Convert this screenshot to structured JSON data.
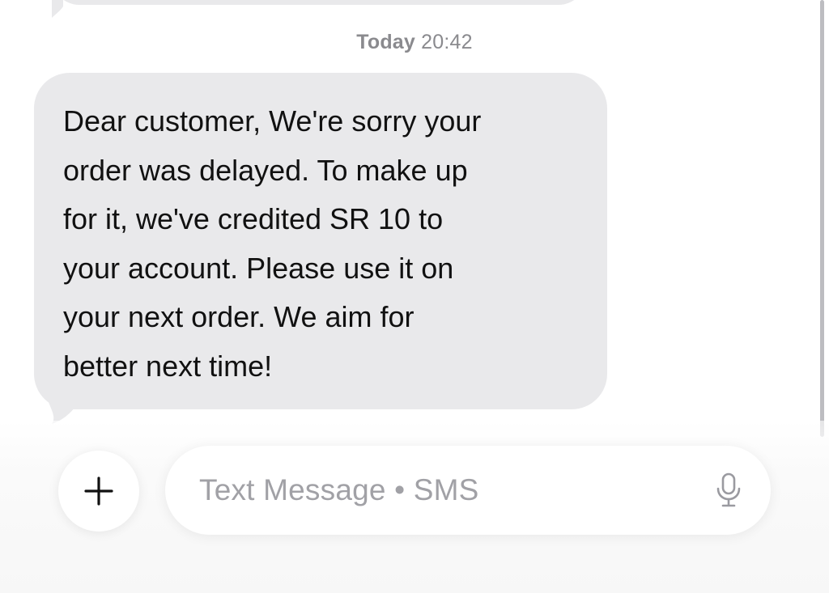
{
  "thread": {
    "timestamp_day": "Today",
    "timestamp_time": "20:42",
    "message": "Dear customer, We're sorry your\norder was delayed. To make up\nfor it, we've credited SR 10 to\nyour account. Please use it on\nyour next order. We aim for\nbetter next time!"
  },
  "composer": {
    "placeholder": "Text Message • SMS",
    "add_icon": "plus-icon",
    "mic_icon": "microphone-icon"
  },
  "colors": {
    "bubble_incoming": "#e9e9eb",
    "timestamp": "#8a8a8e",
    "placeholder": "#a1a1a6"
  }
}
